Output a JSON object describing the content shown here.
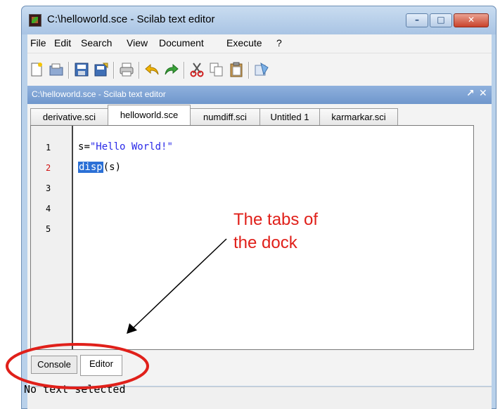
{
  "window": {
    "title": "C:\\helloworld.sce - Scilab text editor",
    "controls": [
      "–",
      "□",
      "✕"
    ]
  },
  "menubar": {
    "items": [
      "File",
      "Edit",
      "Search",
      "View",
      "Document",
      "Execute",
      "?"
    ]
  },
  "toolbar": {
    "icons": [
      "new-file-icon",
      "open-folder-icon",
      "save-icon",
      "save-as-icon",
      "print-icon",
      "undo-icon",
      "redo-icon",
      "cut-icon",
      "copy-icon",
      "paste-icon",
      "execute-icon"
    ]
  },
  "dock": {
    "title": "C:\\helloworld.sce - Scilab text editor",
    "undock": "↗",
    "close": "✕"
  },
  "file_tabs": [
    {
      "label": "derivative.sci"
    },
    {
      "label": "helloworld.sce",
      "active": true
    },
    {
      "label": "numdiff.sci"
    },
    {
      "label": "Untitled 1"
    },
    {
      "label": "karmarkar.sci"
    }
  ],
  "editor": {
    "line_numbers": [
      "1",
      "2",
      "3",
      "4",
      "5"
    ],
    "current_line": 2,
    "lines": [
      {
        "var": "s",
        "op": "=",
        "str": "\"Hello World!\""
      },
      {
        "fn": "disp",
        "args": "(s)"
      }
    ]
  },
  "bottom_tabs": [
    {
      "label": "Console"
    },
    {
      "label": "Editor",
      "active": true
    }
  ],
  "status": "No text selected",
  "annotation": {
    "line1": "The tabs of",
    "line2": "the dock"
  },
  "colors": {
    "annotation": "#e0201a",
    "ring": "#e0201a",
    "selection": "#2b70d6",
    "string": "#2a2ae8"
  }
}
